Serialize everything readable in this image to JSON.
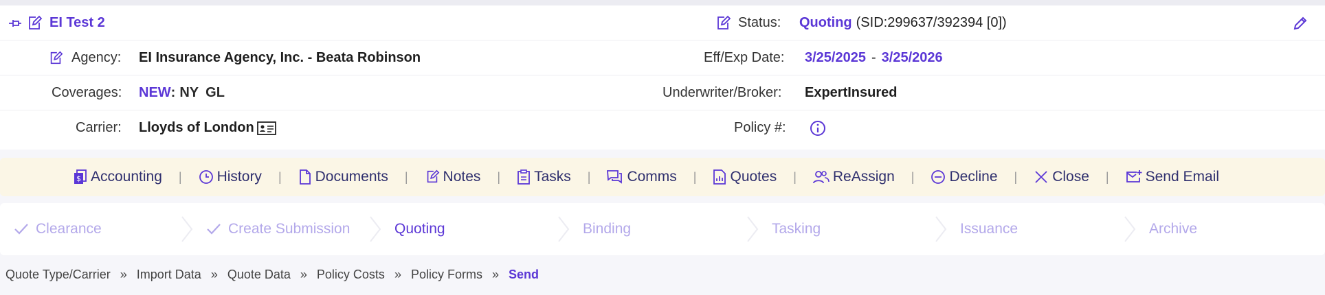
{
  "header": {
    "title": "EI Test 2",
    "status_label": "Status:",
    "status_value": "Quoting",
    "status_sid": "(SID:299637/392394 [0])"
  },
  "agency": {
    "label": "Agency:",
    "value": "EI Insurance Agency, Inc. - Beata Robinson"
  },
  "dates": {
    "label": "Eff/Exp Date:",
    "eff": "3/25/2025",
    "dash": "-",
    "exp": "3/25/2026"
  },
  "coverages": {
    "label": "Coverages:",
    "new": "NEW",
    "colon": ":",
    "state": "NY",
    "line": "GL"
  },
  "broker": {
    "label": "Underwriter/Broker:",
    "value": "ExpertInsured"
  },
  "carrier": {
    "label": "Carrier:",
    "value": "Lloyds of London"
  },
  "policy": {
    "label": "Policy #:"
  },
  "actions": [
    {
      "label": "Accounting",
      "icon": "accounting-icon"
    },
    {
      "label": "History",
      "icon": "clock-icon"
    },
    {
      "label": "Documents",
      "icon": "document-icon"
    },
    {
      "label": "Notes",
      "icon": "note-icon"
    },
    {
      "label": "Tasks",
      "icon": "clipboard-icon"
    },
    {
      "label": "Comms",
      "icon": "chat-icon"
    },
    {
      "label": "Quotes",
      "icon": "chart-doc-icon"
    },
    {
      "label": "ReAssign",
      "icon": "users-icon"
    },
    {
      "label": "Decline",
      "icon": "minus-circle-icon"
    },
    {
      "label": "Close",
      "icon": "x-icon"
    },
    {
      "label": "Send Email",
      "icon": "mail-icon"
    }
  ],
  "separator": "|",
  "steps": [
    {
      "label": "Clearance",
      "state": "done"
    },
    {
      "label": "Create Submission",
      "state": "done"
    },
    {
      "label": "Quoting",
      "state": "active"
    },
    {
      "label": "Binding",
      "state": "pending"
    },
    {
      "label": "Tasking",
      "state": "pending"
    },
    {
      "label": "Issuance",
      "state": "pending"
    },
    {
      "label": "Archive",
      "state": "pending"
    }
  ],
  "breadcrumbs": [
    "Quote Type/Carrier",
    "Import Data",
    "Quote Data",
    "Policy Costs",
    "Policy Forms",
    "Send"
  ],
  "breadcrumb_sep": "»",
  "colors": {
    "accent": "#5b37d6",
    "action_bg": "#fbf6e6",
    "step_pending": "#b3a8ea"
  }
}
